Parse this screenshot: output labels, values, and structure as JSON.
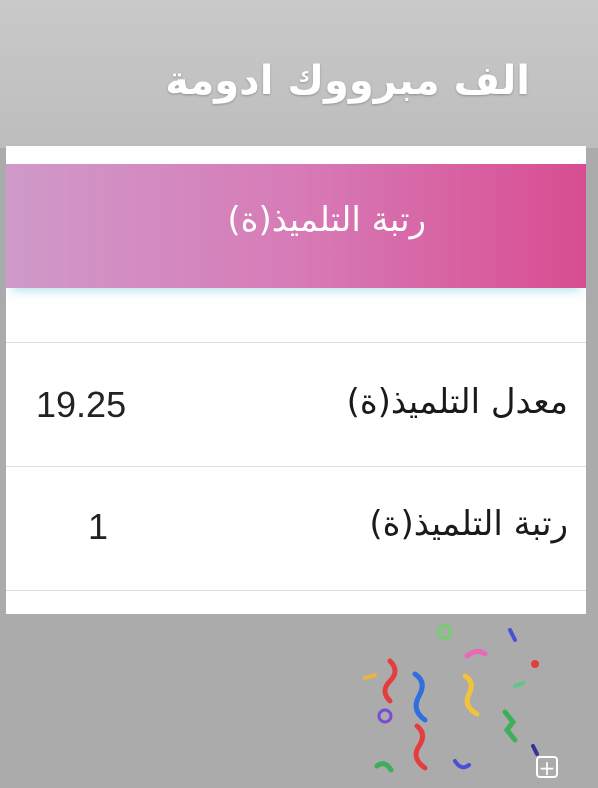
{
  "story": {
    "caption": "الف مبرووك ادومة",
    "sticker_icon": "confetti-sticker",
    "add_icon": "plus-square-icon"
  },
  "card": {
    "header_title": "رتبة التلميذ(ة)",
    "rows": [
      {
        "label": "معدل التلميذ(ة)",
        "value": "19.25"
      },
      {
        "label": "رتبة التلميذ(ة)",
        "value": "1"
      }
    ]
  },
  "colors": {
    "header_gradient_start": "#cf9ac9",
    "header_gradient_end": "#d84d92",
    "caption_text": "#ffffff"
  }
}
